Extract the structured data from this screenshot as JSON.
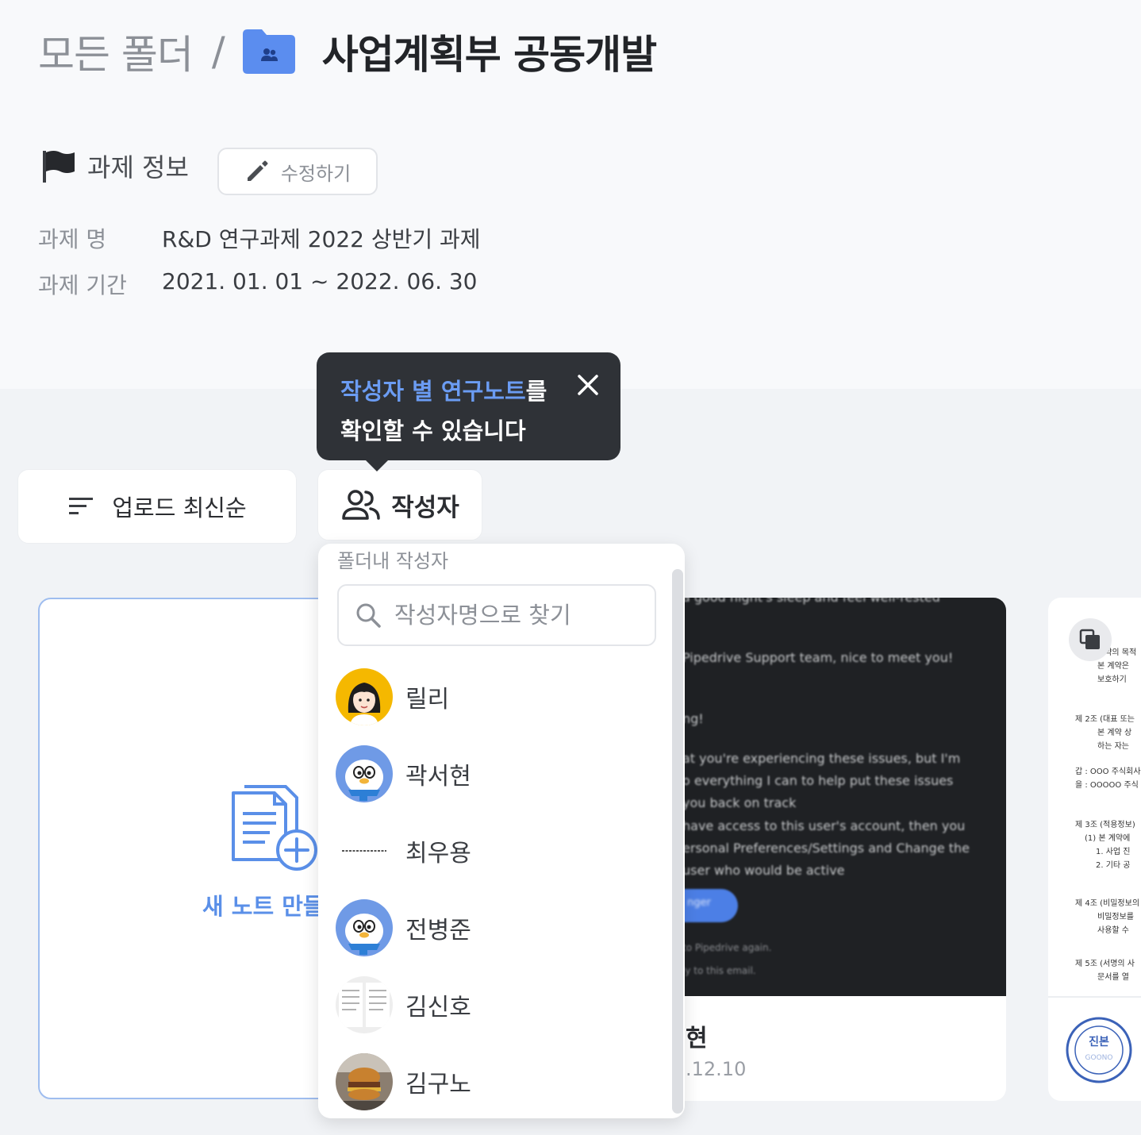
{
  "breadcrumb": {
    "root": "모든 폴더",
    "separator": "/",
    "folder_icon": "shared-folder-icon",
    "current": "사업계획부 공동개발"
  },
  "task_info": {
    "title": "과제 정보",
    "flag_icon": "flag-icon",
    "edit_label": "수정하기",
    "rows": [
      {
        "key": "과제 명",
        "value": "R&D 연구과제 2022 상반기 과제"
      },
      {
        "key": "과제 기간",
        "value": "2021. 01. 01 ~ 2022. 06. 30"
      }
    ]
  },
  "toolbar": {
    "sort_label": "업로드 최신순",
    "writer_label": "작성자"
  },
  "tooltip": {
    "highlight": "작성자 별 연구노트",
    "line1_rest": "를",
    "line2": "확인할 수 있습니다"
  },
  "new_note": {
    "label": "새 노트 만들"
  },
  "writer_dropdown": {
    "title": "폴더내 작성자",
    "search_placeholder": "작성자명으로 찾기",
    "writers": [
      {
        "name": "릴리",
        "avatar": "girl-avatar"
      },
      {
        "name": "곽서현",
        "avatar": "penguin-avatar"
      },
      {
        "name": "최우용",
        "avatar": "text-logo-avatar"
      },
      {
        "name": "전병준",
        "avatar": "penguin-avatar"
      },
      {
        "name": "김신호",
        "avatar": "document-avatar"
      },
      {
        "name": "김구노",
        "avatar": "burger-photo-avatar"
      }
    ]
  },
  "note_card": {
    "lines": [
      "a good night's sleep and feel well-rested",
      "Pipedrive Support team, nice to meet you!",
      "ng!",
      "at you're experiencing these issues, but I'm",
      "o everything I can to help put these issues",
      "you back on track",
      "have access to this user's account, then you",
      "ersonal Preferences/Settings and Change the",
      "user who would be active",
      "to Pipedrive again.",
      "ly to this email."
    ],
    "button_text": "nger",
    "author": "현",
    "date": ".12.10"
  },
  "contract_card": {
    "lines": [
      "계약의 목적",
      "본 계약은",
      "보호하기",
      "제 2조 (대표 또는",
      "본 계약 상",
      "하는 자는",
      "갑 : OOO 주식회사",
      "을 : OOOOO 주식",
      "제 3조 (적용정보)",
      "(1) 본 계약에",
      "1.  사업 진",
      "2.  기타 공",
      "제 4조 (비밀정보의",
      "비밀정보를",
      "사용할 수",
      "제 5조 (서명의 사",
      "문서를 열"
    ],
    "stamp_text": "진본"
  },
  "colors": {
    "accent": "#5a8fe8",
    "tooltip_bg": "#2f3237",
    "tooltip_highlight": "#6b9cf3",
    "folder": "#5b8def"
  }
}
